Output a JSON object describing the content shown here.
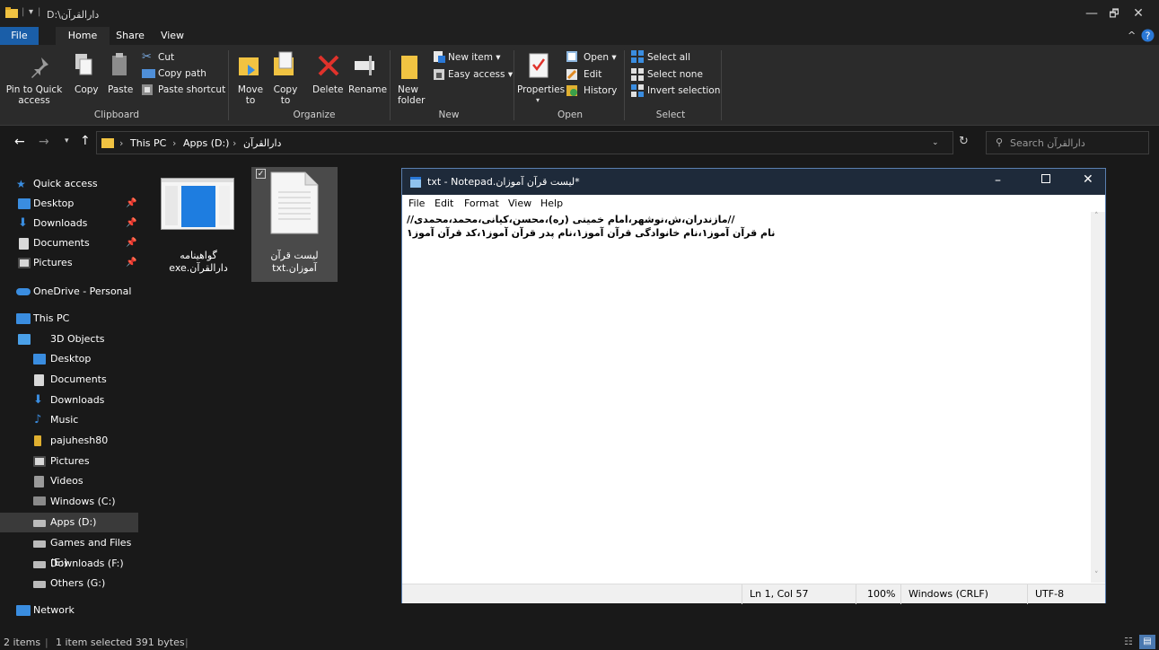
{
  "window": {
    "title": "D:\\دارالقرآن",
    "minimize": "—",
    "maximize": "🗗",
    "close": "✕"
  },
  "menu_tabs": [
    "File",
    "Home",
    "Share",
    "View"
  ],
  "ribbon": {
    "clipboard": {
      "pin_to_quick_access": "Pin to Quick access",
      "copy": "Copy",
      "paste": "Paste",
      "cut": "Cut",
      "copy_path": "Copy path",
      "paste_shortcut": "Paste shortcut",
      "group_label": "Clipboard"
    },
    "organize": {
      "move_to": "Move to",
      "copy_to": "Copy to",
      "delete": "Delete",
      "rename": "Rename",
      "group_label": "Organize"
    },
    "new": {
      "new_folder": "New folder",
      "new_item": "New item",
      "easy_access": "Easy access",
      "group_label": "New"
    },
    "open": {
      "properties": "Properties",
      "open": "Open",
      "edit": "Edit",
      "history": "History",
      "group_label": "Open"
    },
    "select": {
      "select_all": "Select all",
      "select_none": "Select none",
      "invert_selection": "Invert selection",
      "group_label": "Select"
    }
  },
  "address": {
    "crumbs": [
      "This PC",
      "Apps (D:)",
      "دارالقرآن"
    ],
    "search_placeholder": "Search دارالقرآن"
  },
  "sidebar": {
    "quick_access": "Quick access",
    "quick_items": [
      "Desktop",
      "Downloads",
      "Documents",
      "Pictures"
    ],
    "onedrive": "OneDrive - Personal",
    "this_pc": "This PC",
    "pc_items": [
      "3D Objects",
      "Desktop",
      "Documents",
      "Downloads",
      "Music",
      "pajuhesh80",
      "Pictures",
      "Videos",
      "Windows (C:)",
      "Apps (D:)",
      "Games and Files (E:)",
      "Downloads (F:)",
      "Others (G:)"
    ],
    "network": "Network"
  },
  "files": [
    {
      "name_line1": "گواهینامه",
      "name_line2": "دارالقرآن.exe",
      "type": "exe"
    },
    {
      "name_line1": "لیست قرآن",
      "name_line2": "آموزان.txt",
      "type": "txt"
    }
  ],
  "notepad": {
    "title": "*لیست قرآن آموزان.txt - Notepad",
    "menu": [
      "File",
      "Edit",
      "Format",
      "View",
      "Help"
    ],
    "lines": [
      "//مازندران،ش،نوشهر،امام خمینی (ره)،محسن،کیانی،محمد،محمدی//",
      "نام قرآن آموز۱،نام خانوادگی قرآن آموز۱،نام پدر قرآن آموز۱،کد قرآن آموز۱"
    ],
    "status": {
      "position": "Ln 1, Col 57",
      "zoom": "100%",
      "line_ending": "Windows (CRLF)",
      "encoding": "UTF-8"
    }
  },
  "statusbar": {
    "items": "2 items",
    "selected": "1 item selected  391 bytes"
  }
}
